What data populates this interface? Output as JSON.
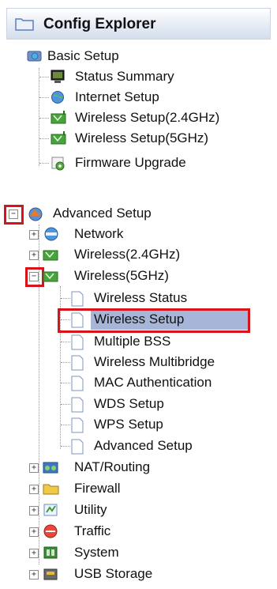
{
  "panel": {
    "title": "Config Explorer"
  },
  "basic": {
    "label": "Basic Setup",
    "items": [
      {
        "label": "Status Summary",
        "icon": "monitor-icon"
      },
      {
        "label": "Internet Setup",
        "icon": "globe-icon"
      },
      {
        "label": "Wireless Setup(2.4GHz)",
        "icon": "wireless-icon"
      },
      {
        "label": "Wireless Setup(5GHz)",
        "icon": "wireless-icon"
      },
      {
        "label": "Firmware Upgrade",
        "icon": "gear-icon"
      }
    ]
  },
  "advanced": {
    "label": "Advanced Setup",
    "expander": "−",
    "network": "Network",
    "wireless24": "Wireless(2.4GHz)",
    "wireless5": "Wireless(5GHz)",
    "wireless5_items": [
      "Wireless Status",
      "Wireless Setup",
      "Multiple BSS",
      "Wireless Multibridge",
      "MAC Authentication",
      "WDS Setup",
      "WPS Setup",
      "Advanced Setup"
    ],
    "others": [
      {
        "label": "NAT/Routing",
        "icon": "routing-icon"
      },
      {
        "label": "Firewall",
        "icon": "firewall-icon"
      },
      {
        "label": "Utility",
        "icon": "utility-icon"
      },
      {
        "label": "Traffic",
        "icon": "traffic-icon"
      },
      {
        "label": "System",
        "icon": "system-icon"
      },
      {
        "label": "USB Storage",
        "icon": "usb-storage-icon"
      }
    ],
    "plus": "+"
  },
  "colors": {
    "highlight": "#d8141b",
    "selection": "#a7b6d8"
  }
}
